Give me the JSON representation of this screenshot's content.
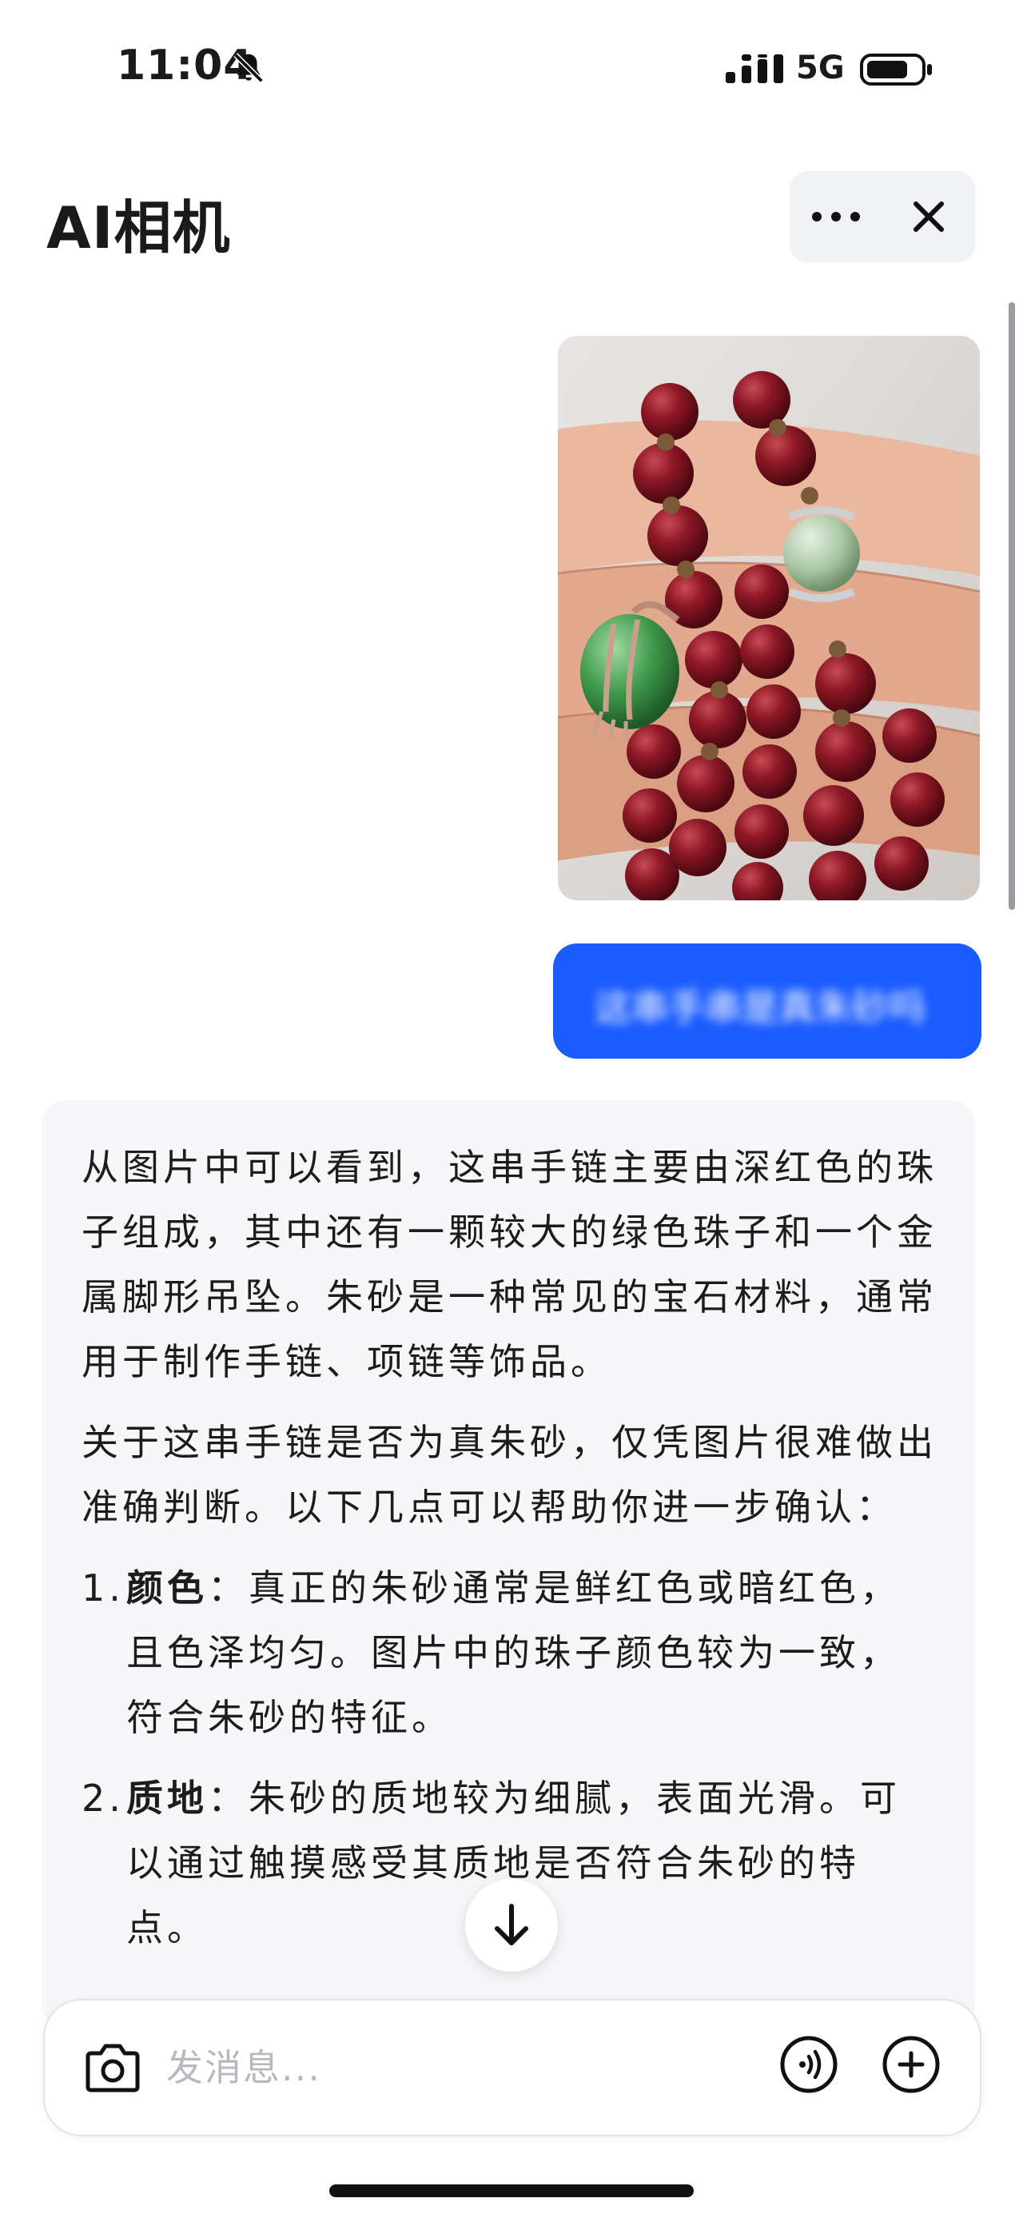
{
  "status_bar": {
    "time": "11:04",
    "network": "5G",
    "icons": [
      "bell-mute-icon",
      "signal-icon",
      "battery-icon"
    ]
  },
  "header": {
    "title": "AI相机",
    "actions": [
      "more-icon",
      "close-icon"
    ]
  },
  "conversation": {
    "user_image": "red bead bracelet photo",
    "user_message": "这串手串是真朱砂吗",
    "ai_reply": {
      "paragraph_1": "从图片中可以看到，这串手链主要由深红色的珠子组成，其中还有一颗较大的绿色珠子和一个金属脚形吊坠。朱砂是一种常见的宝石材料，通常用于制作手链、项链等饰品。",
      "paragraph_2": "关于这串手链是否为真朱砂，仅凭图片很难做出准确判断。以下几点可以帮助你进一步确认：",
      "points": [
        {
          "num": "1.",
          "title": "颜色",
          "text": "：真正的朱砂通常是鲜红色或暗红色，且色泽均匀。图片中的珠子颜色较为一致，符合朱砂的特征。"
        },
        {
          "num": "2.",
          "title": "质地",
          "text": "：朱砂的质地较为细腻，表面光滑。可以通过触摸感受其质地是否符合朱砂的特点。"
        }
      ]
    }
  },
  "input": {
    "placeholder": "发消息..."
  },
  "colors": {
    "accent": "#1a5cff",
    "card_bg": "#f7f7f9"
  }
}
